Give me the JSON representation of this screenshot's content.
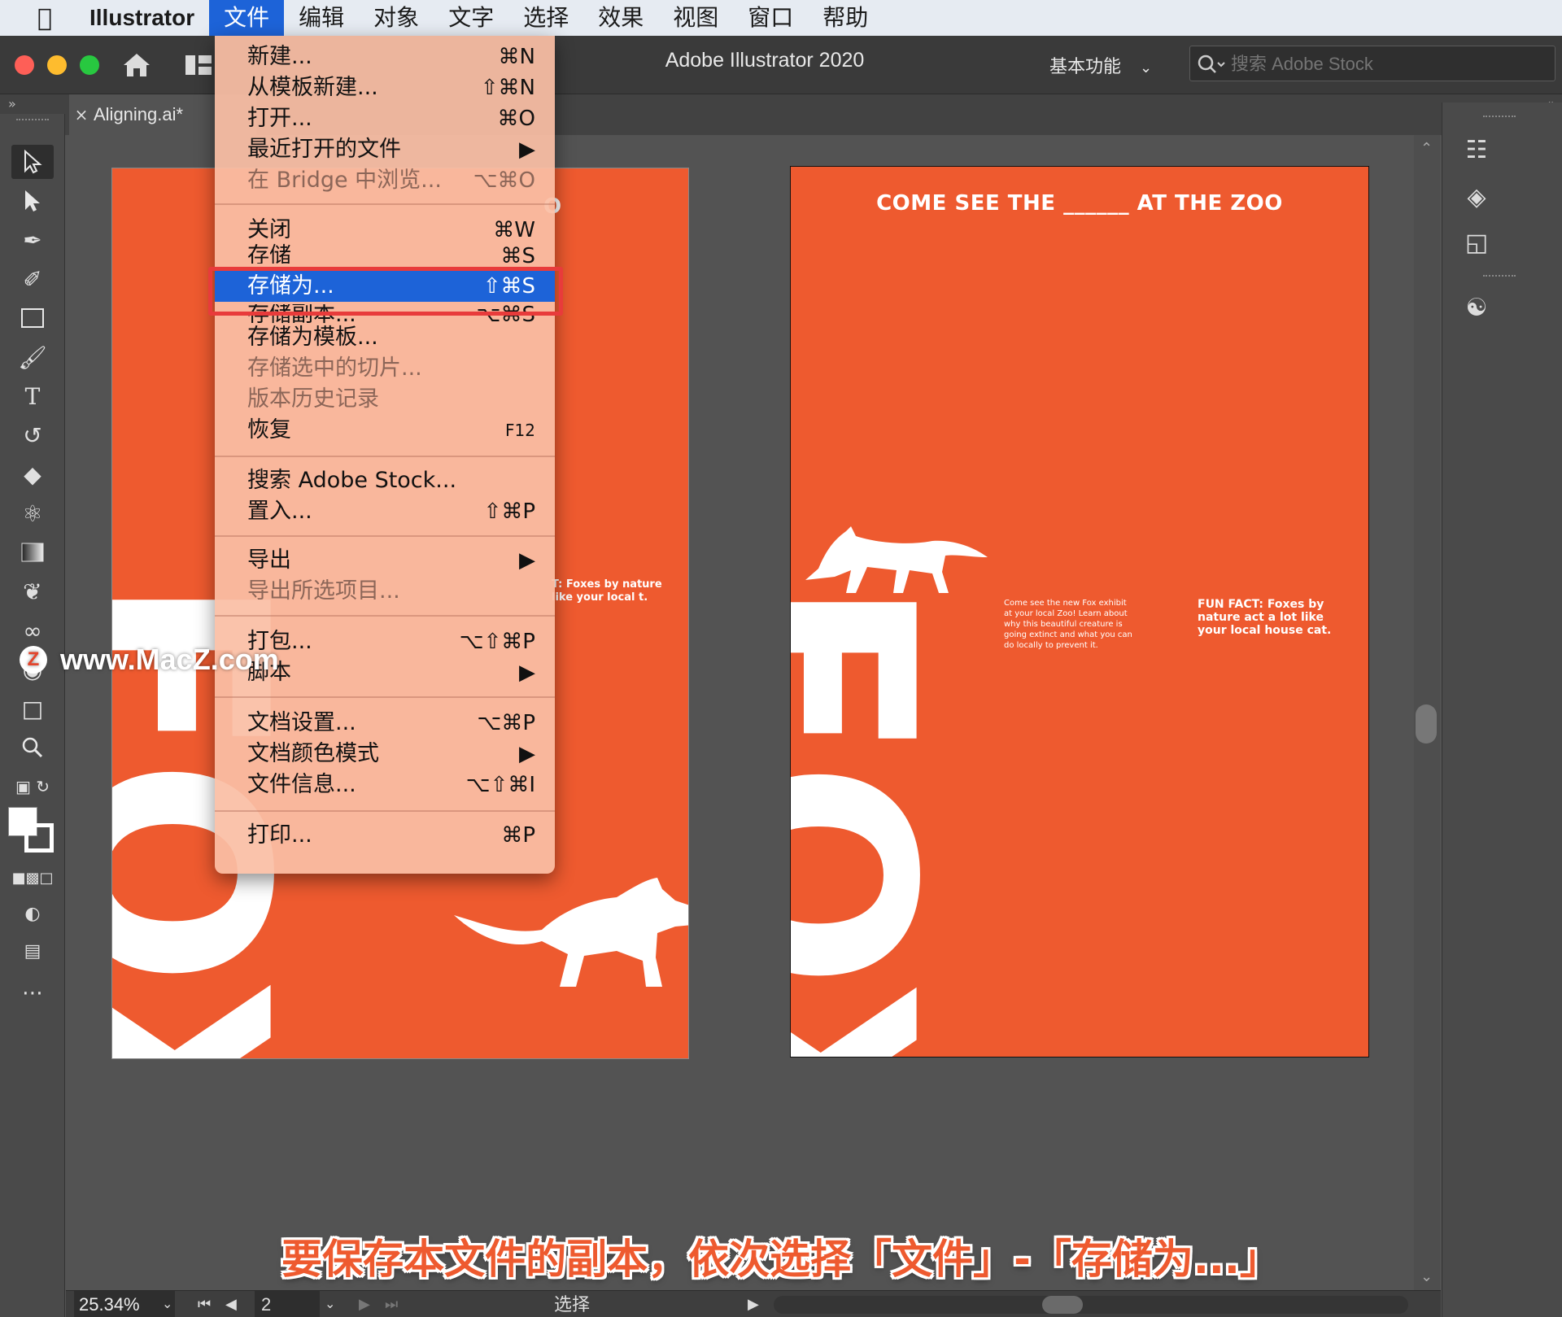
{
  "menubar": {
    "app_name": "Illustrator",
    "items": [
      "文件",
      "编辑",
      "对象",
      "文字",
      "选择",
      "效果",
      "视图",
      "窗口",
      "帮助"
    ]
  },
  "window": {
    "title": "Adobe Illustrator 2020",
    "workspace": "基本功能",
    "stock_search_placeholder": "搜索 Adobe Stock"
  },
  "tab": {
    "label": "Aligning.ai*"
  },
  "file_menu": {
    "items": [
      {
        "label": "新建...",
        "shortcut": "⌘N"
      },
      {
        "label": "从模板新建...",
        "shortcut": "⇧⌘N"
      },
      {
        "label": "打开...",
        "shortcut": "⌘O"
      },
      {
        "label": "最近打开的文件",
        "shortcut": "▶"
      },
      {
        "label": "在 Bridge 中浏览...",
        "shortcut": "⌥⌘O"
      },
      {
        "label": "关闭",
        "shortcut": "⌘W"
      },
      {
        "label": "存储",
        "shortcut": "⌘S"
      },
      {
        "label": "存储为...",
        "shortcut": "⇧⌘S"
      },
      {
        "label": "存储副本...",
        "shortcut": "⌥⌘S"
      },
      {
        "label": "存储为模板...",
        "shortcut": ""
      },
      {
        "label": "存储选中的切片...",
        "shortcut": ""
      },
      {
        "label": "版本历史记录",
        "shortcut": ""
      },
      {
        "label": "恢复",
        "shortcut": "F12"
      },
      {
        "label": "搜索 Adobe Stock...",
        "shortcut": ""
      },
      {
        "label": "置入...",
        "shortcut": "⇧⌘P"
      },
      {
        "label": "导出",
        "shortcut": "▶"
      },
      {
        "label": "导出所选项目...",
        "shortcut": ""
      },
      {
        "label": "打包...",
        "shortcut": "⌥⇧⌘P"
      },
      {
        "label": "脚本",
        "shortcut": "▶"
      },
      {
        "label": "文档设置...",
        "shortcut": "⌥⌘P"
      },
      {
        "label": "文档颜色模式",
        "shortcut": "▶"
      },
      {
        "label": "文件信息...",
        "shortcut": "⌥⇧⌘I"
      },
      {
        "label": "打印...",
        "shortcut": "⌘P"
      }
    ]
  },
  "artboard": {
    "headline": "COME SEE THE ______ AT THE ZOO",
    "fox_word": "FOX",
    "body_copy": "Come see the new Fox exhibit at your local Zoo! Learn about why this beautiful creature is going extinct and what you can do locally to prevent it.",
    "fun_fact": "FUN FACT: Foxes by nature act a lot like your local house cat.",
    "left_fact_partial": "T: Foxes by nature like your local t.",
    "left_head_partial": "O"
  },
  "status": {
    "zoom": "25.34%",
    "page": "2",
    "mode": "选择"
  },
  "watermark": {
    "logo": "Z",
    "text": "www.MacZ.com"
  },
  "caption": "要保存本文件的副本，依次选择「文件」-「存储为...」",
  "colors": {
    "poster_orange": "#ee5a2f",
    "menu_highlight": "#1d63d8",
    "callout_red": "#e83b3b"
  }
}
